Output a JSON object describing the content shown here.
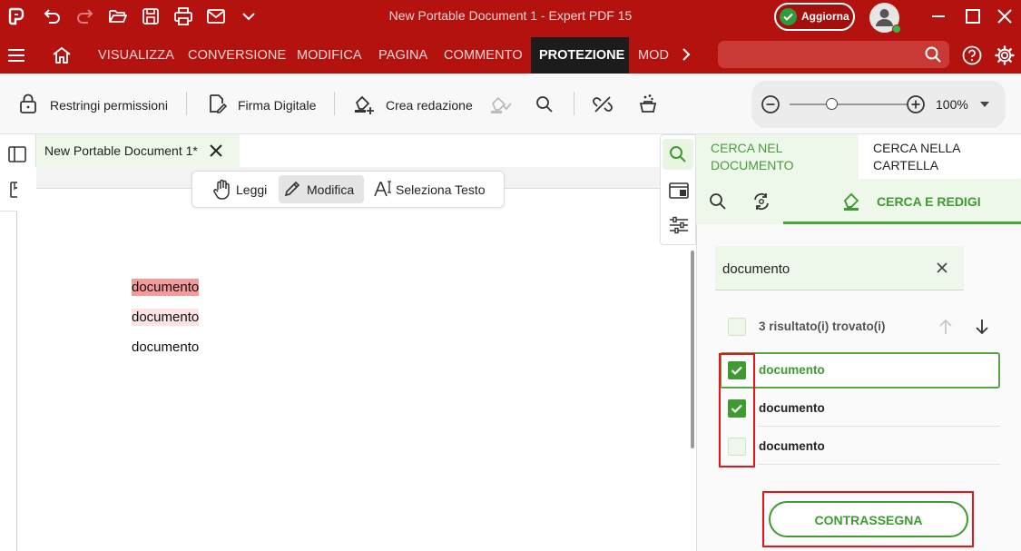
{
  "window": {
    "title": "New Portable Document 1   -   Expert PDF 15",
    "upgrade_label": "Aggiorna"
  },
  "ribbon": {
    "tabs": [
      "VISUALIZZA",
      "CONVERSIONE",
      "MODIFICA",
      "PAGINA",
      "COMMENTO",
      "PROTEZIONE",
      "MOD"
    ],
    "active_tab": "PROTEZIONE",
    "search_placeholder": ""
  },
  "toolbar": {
    "restrict_label": "Restringi permissioni",
    "signature_label": "Firma Digitale",
    "redaction_label": "Crea redazione",
    "zoom_value": "100%",
    "zoom_level": 0.35
  },
  "document": {
    "tab_title": "New Portable Document 1*",
    "modes": [
      "Leggi",
      "Modifica",
      "Seleziona Testo"
    ],
    "active_mode": "Modifica",
    "words": [
      "documento",
      "documento",
      "documento"
    ],
    "highlight_colors": [
      "#f59a9a",
      "#fde3e3",
      "#ffffff"
    ]
  },
  "panel": {
    "tab_search_document": "CERCA NEL DOCUMENTO",
    "tab_search_folder": "CERCA NELLA CARTELLA",
    "subtab_label": "CERCA E REDIGI",
    "search_value": "documento",
    "results_count": "3 risultato(i) trovato(i)",
    "results": [
      {
        "label": "documento",
        "checked": true
      },
      {
        "label": "documento",
        "checked": true
      },
      {
        "label": "documento",
        "checked": false
      }
    ],
    "mark_button": "CONTRASSEGNA"
  },
  "colors": {
    "brand_red": "#b3120f",
    "accent_green": "#3f9a31",
    "annotation_red": "#e8131b"
  }
}
